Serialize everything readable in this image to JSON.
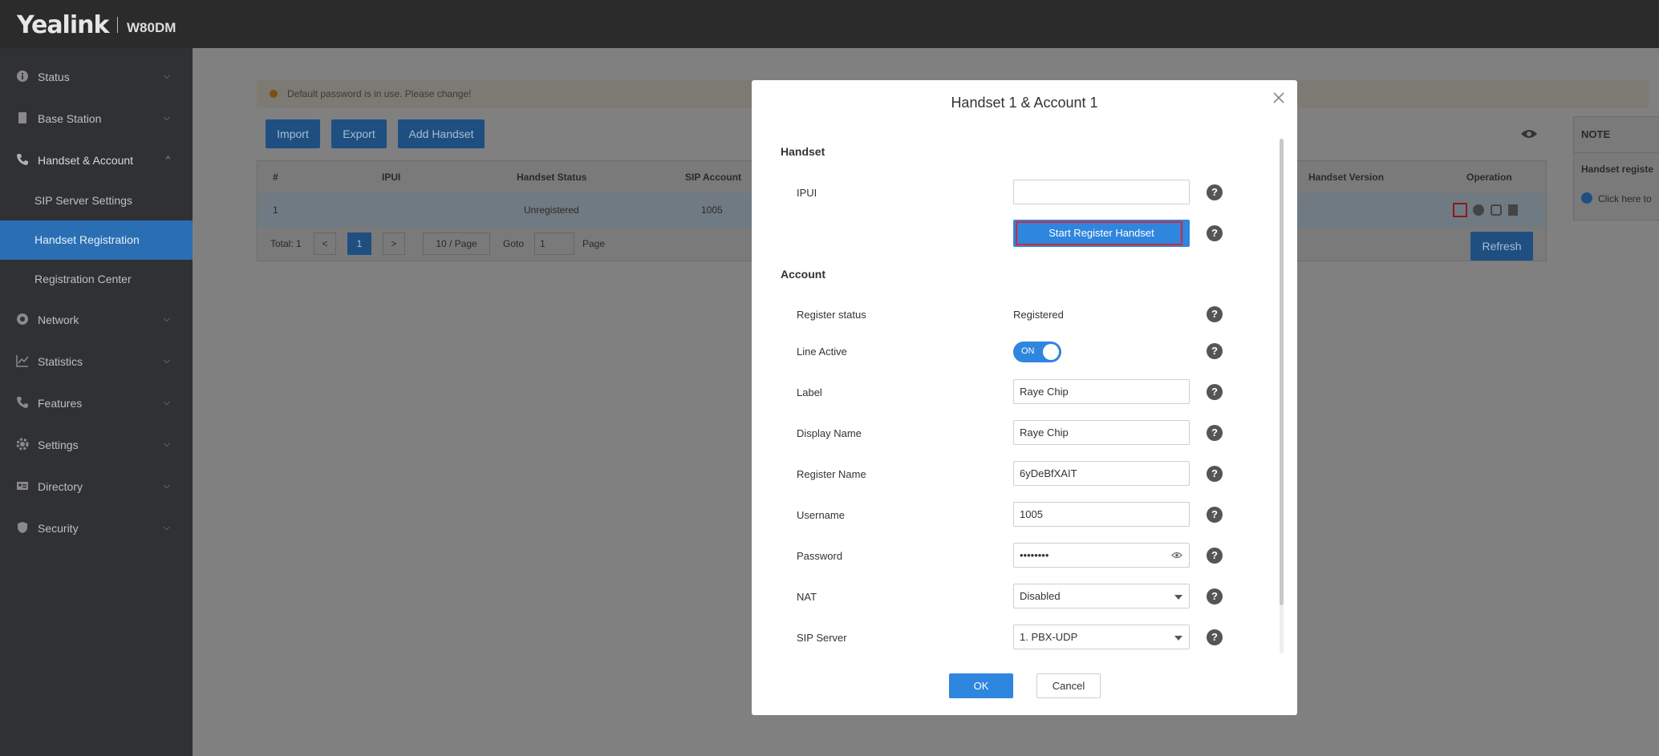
{
  "header": {
    "brand": "Yealink",
    "model": "W80DM"
  },
  "sidebar": {
    "items": [
      {
        "label": "Status",
        "icon": "info-icon"
      },
      {
        "label": "Base Station",
        "icon": "base-station-icon"
      },
      {
        "label": "Handset & Account",
        "icon": "phone-icon",
        "expanded": true
      },
      {
        "label": "Network",
        "icon": "network-icon"
      },
      {
        "label": "Statistics",
        "icon": "chart-icon"
      },
      {
        "label": "Features",
        "icon": "features-icon"
      },
      {
        "label": "Settings",
        "icon": "gear-icon"
      },
      {
        "label": "Directory",
        "icon": "contact-card-icon"
      },
      {
        "label": "Security",
        "icon": "shield-icon"
      }
    ],
    "subitems": [
      {
        "label": "SIP Server Settings"
      },
      {
        "label": "Handset Registration",
        "active": true
      },
      {
        "label": "Registration Center"
      }
    ]
  },
  "main": {
    "warning": "Default password is in use. Please change!",
    "buttons": {
      "import": "Import",
      "export": "Export",
      "add_handset": "Add Handset",
      "refresh": "Refresh"
    },
    "table": {
      "headers": {
        "num": "#",
        "ipui": "IPUI",
        "status": "Handset Status",
        "sip": "SIP Account",
        "version": "Handset Version",
        "operation": "Operation"
      },
      "row": {
        "num": "1",
        "status": "Unregistered",
        "sip": "1005"
      }
    },
    "pager": {
      "total": "Total: 1",
      "prev": "<",
      "page": "1",
      "next": ">",
      "per_page": "10 / Page",
      "goto": "Goto",
      "goto_value": "1",
      "page_label": "Page"
    },
    "note": {
      "title": "NOTE",
      "line1": "Handset registe",
      "line2": "Click here to"
    }
  },
  "modal": {
    "title": "Handset 1 & Account 1",
    "handset_section": "Handset",
    "ipui_label": "IPUI",
    "ipui_value": "",
    "register_button": "Start Register Handset",
    "account_section": "Account",
    "fields": {
      "register_status": {
        "label": "Register status",
        "value": "Registered"
      },
      "line_active": {
        "label": "Line Active",
        "value": "ON"
      },
      "label": {
        "label": "Label",
        "value": "Raye Chip"
      },
      "display_name": {
        "label": "Display Name",
        "value": "Raye Chip"
      },
      "register_name": {
        "label": "Register Name",
        "value": "6yDeBfXAIT"
      },
      "username": {
        "label": "Username",
        "value": "1005"
      },
      "password": {
        "label": "Password",
        "value": "••••••••"
      },
      "nat": {
        "label": "NAT",
        "value": "Disabled"
      },
      "sip_server": {
        "label": "SIP Server",
        "value": "1. PBX-UDP"
      }
    },
    "ok": "OK",
    "cancel": "Cancel",
    "help_glyph": "?"
  },
  "colors": {
    "primary": "#2e86de",
    "sidebar": "#303134",
    "topbar": "#2b2b2c",
    "highlight": "#d9262e"
  }
}
